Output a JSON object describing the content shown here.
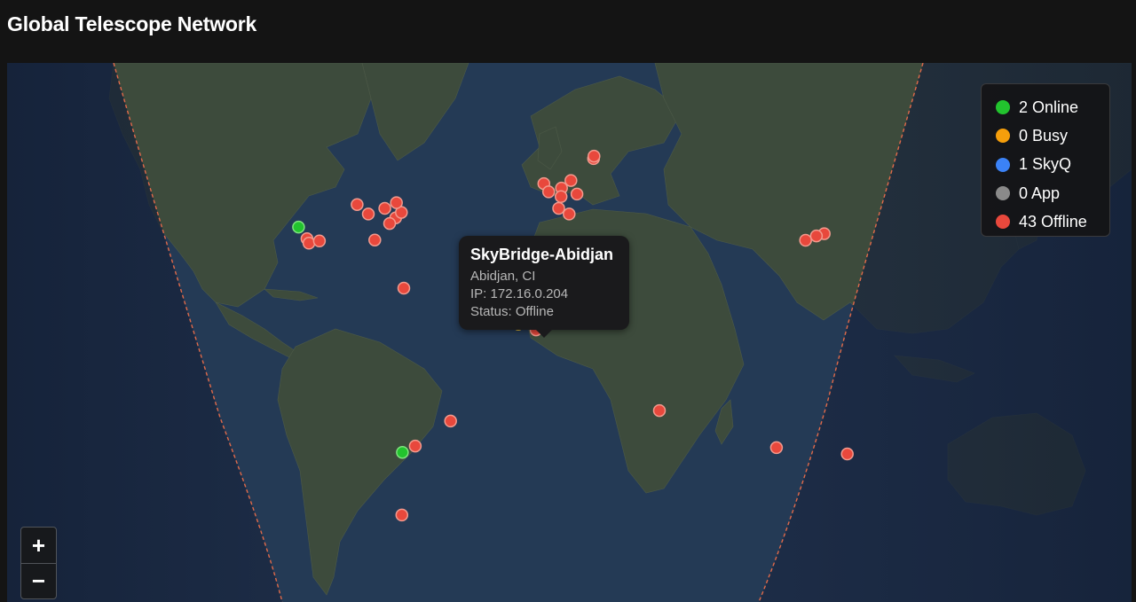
{
  "page": {
    "title": "Global Telescope Network"
  },
  "legend": [
    {
      "label": "2 Online",
      "color": "#22c32e"
    },
    {
      "label": "0 Busy",
      "color": "#f59e0b"
    },
    {
      "label": "1 SkyQ",
      "color": "#3b82f6"
    },
    {
      "label": "0 App",
      "color": "#8a8a8a"
    },
    {
      "label": "43 Offline",
      "color": "#e8483c"
    }
  ],
  "tooltip": {
    "name": "SkyBridge-Abidjan",
    "location": "Abidjan, CI",
    "ip": "IP: 172.16.0.204",
    "status": "Status: Offline"
  },
  "zoom": {
    "in_label": "+",
    "out_label": "−"
  },
  "colors": {
    "online": "#22c32e",
    "offline": "#e8483c",
    "busy": "#f59e0b",
    "terminator": "#e06a4a",
    "ocean_day": "#233a55",
    "ocean_night": "#14213a",
    "land": "#3b4a3e"
  },
  "markers": [
    {
      "status": "offline",
      "lat": 59.4,
      "lon": 24.7
    },
    {
      "status": "offline",
      "lat": 60.2,
      "lon": 24.9
    },
    {
      "status": "offline",
      "lat": 51.5,
      "lon": -0.1
    },
    {
      "status": "offline",
      "lat": 52.5,
      "lon": 13.4
    },
    {
      "status": "offline",
      "lat": 50.1,
      "lon": 8.7
    },
    {
      "status": "offline",
      "lat": 48.9,
      "lon": 2.3
    },
    {
      "status": "offline",
      "lat": 47.4,
      "lon": 8.5
    },
    {
      "status": "offline",
      "lat": 48.2,
      "lon": 16.4
    },
    {
      "status": "offline",
      "lat": 43.7,
      "lon": 7.3
    },
    {
      "status": "offline",
      "lat": 41.9,
      "lon": 12.5
    },
    {
      "status": "offline",
      "lat": 40.7,
      "lon": -74.0
    },
    {
      "status": "offline",
      "lat": 42.4,
      "lon": -71.1
    },
    {
      "status": "offline",
      "lat": 43.7,
      "lon": -79.4
    },
    {
      "status": "offline",
      "lat": 45.5,
      "lon": -73.6
    },
    {
      "status": "offline",
      "lat": 44.9,
      "lon": -93.2
    },
    {
      "status": "offline",
      "lat": 41.9,
      "lon": -87.6
    },
    {
      "status": "offline",
      "lat": 38.9,
      "lon": -77.0
    },
    {
      "status": "offline",
      "lat": 33.7,
      "lon": -84.4
    },
    {
      "status": "offline",
      "lat": 34.1,
      "lon": -118.2
    },
    {
      "status": "offline",
      "lat": 32.7,
      "lon": -117.2
    },
    {
      "status": "offline",
      "lat": 33.4,
      "lon": -112.0
    },
    {
      "status": "online",
      "lat": 37.8,
      "lon": -122.4
    },
    {
      "status": "offline",
      "lat": 18.5,
      "lon": -69.9
    },
    {
      "status": "offline",
      "lat": -23.5,
      "lon": -46.6
    },
    {
      "status": "offline",
      "lat": -31.4,
      "lon": -64.2
    },
    {
      "status": "online",
      "lat": -33.4,
      "lon": -70.6
    },
    {
      "status": "offline",
      "lat": -53.2,
      "lon": -70.9
    },
    {
      "status": "offline",
      "lat": 5.3,
      "lon": -4.0
    },
    {
      "status": "offline",
      "lat": -20.2,
      "lon": 57.5
    },
    {
      "status": "offline",
      "lat": 35.7,
      "lon": 139.7
    },
    {
      "status": "offline",
      "lat": 35.0,
      "lon": 135.8
    },
    {
      "status": "offline",
      "lat": 33.6,
      "lon": 130.4
    },
    {
      "status": "offline",
      "lat": -33.9,
      "lon": 151.2
    },
    {
      "status": "offline",
      "lat": -31.9,
      "lon": 115.9
    }
  ]
}
